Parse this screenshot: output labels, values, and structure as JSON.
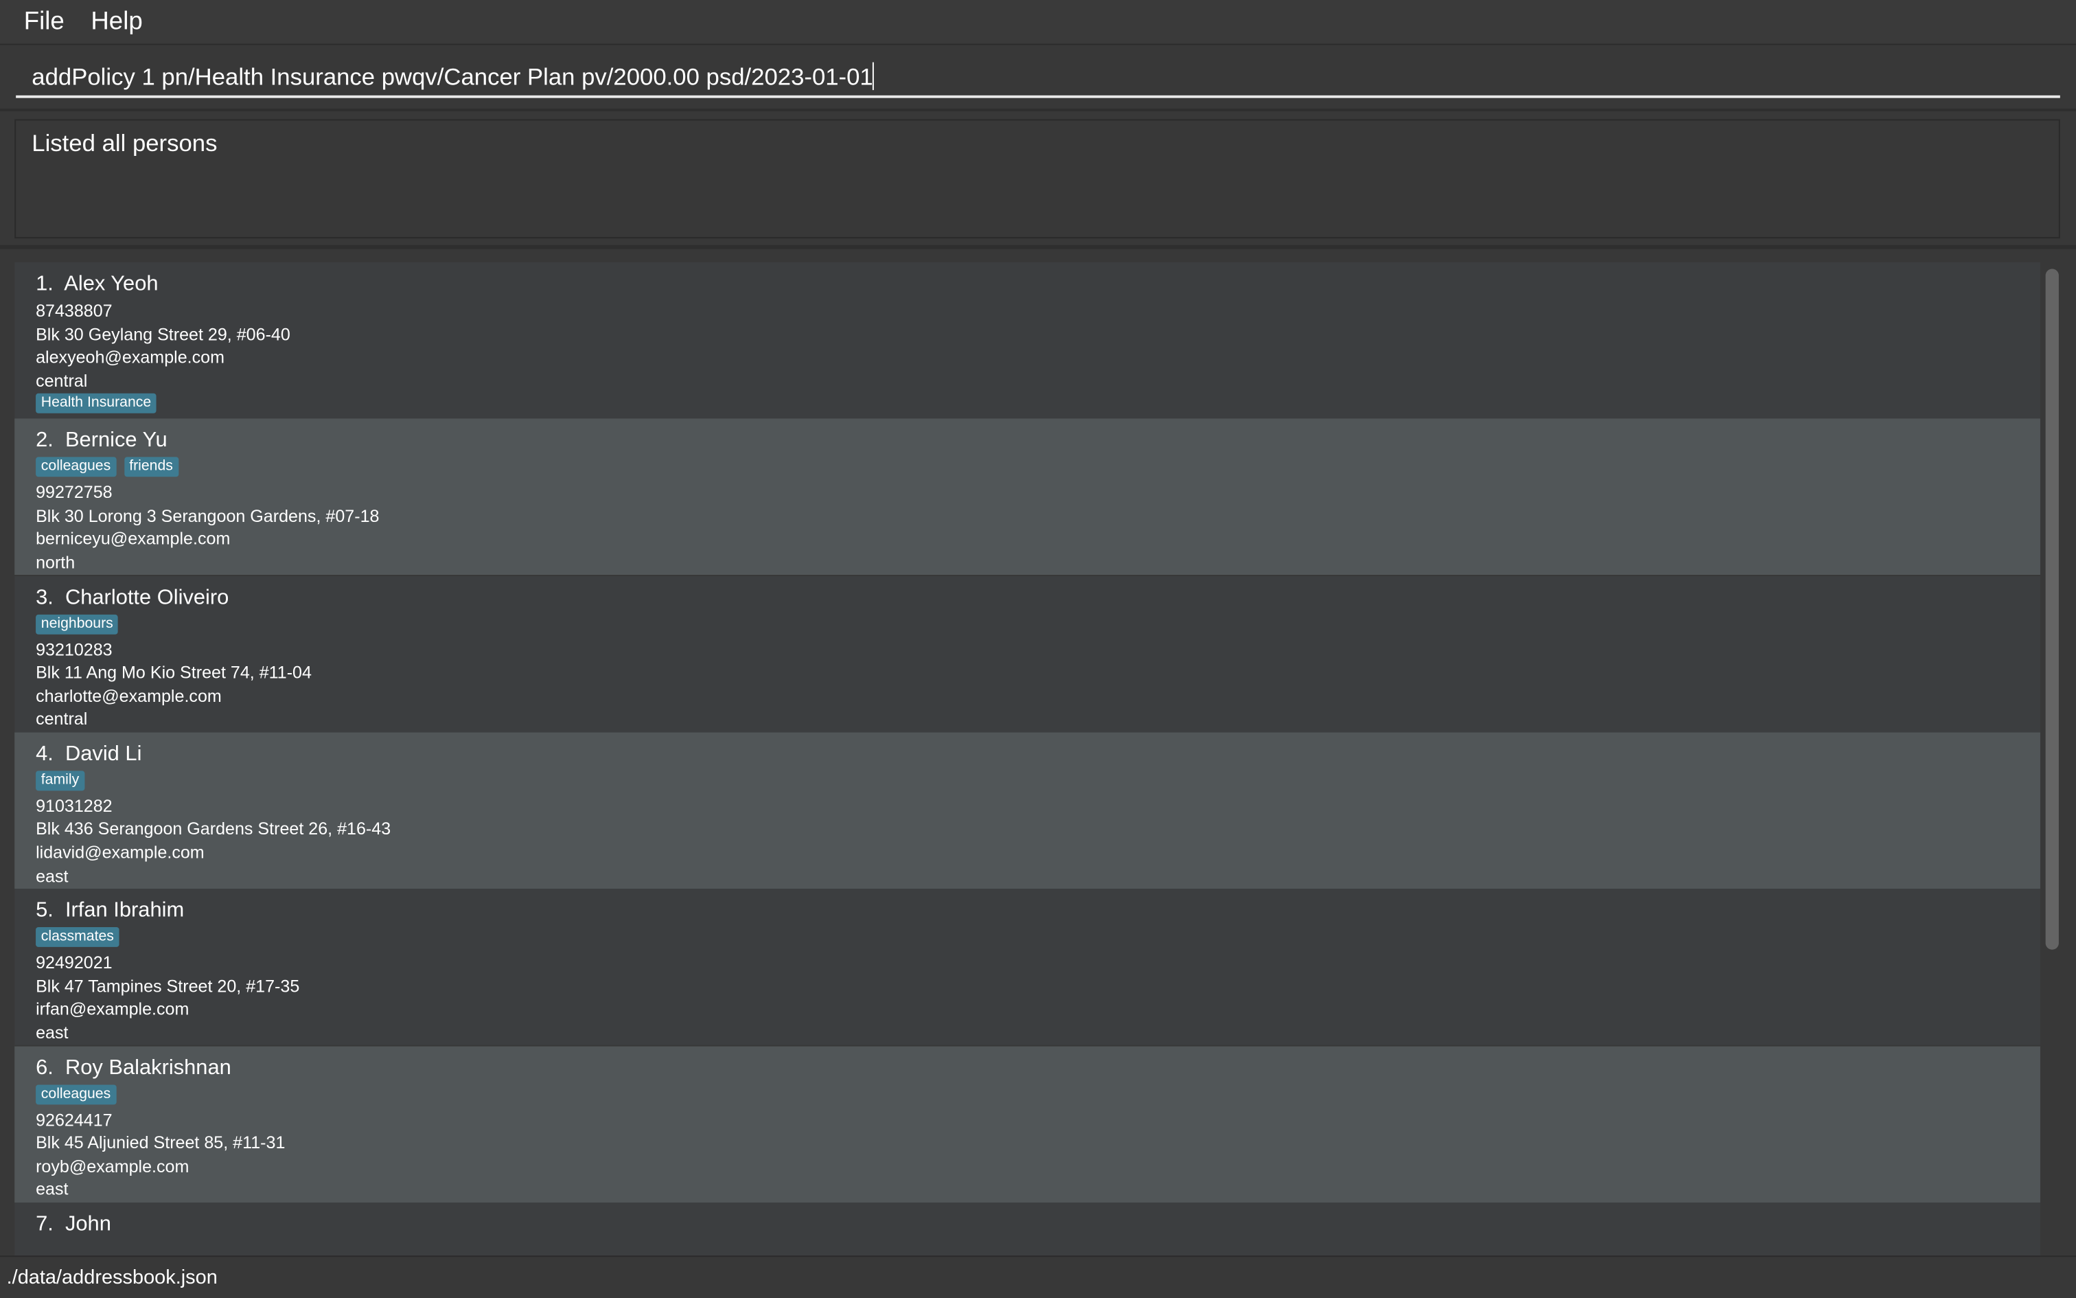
{
  "menu": {
    "file": "File",
    "help": "Help"
  },
  "command": {
    "value": "addPolicy 1 pn/Health Insurance pwqv/Cancer Plan pv/2000.00 psd/2023-01-01"
  },
  "result": {
    "text": "Listed all persons"
  },
  "persons": [
    {
      "index": "1.",
      "name": "Alex Yeoh",
      "tags_before": [],
      "phone": "87438807",
      "address": "Blk 30 Geylang Street 29, #06-40",
      "email": "alexyeoh@example.com",
      "region": "central",
      "tags_after": [
        "Health Insurance"
      ]
    },
    {
      "index": "2.",
      "name": "Bernice Yu",
      "tags_before": [
        "colleagues",
        "friends"
      ],
      "phone": "99272758",
      "address": "Blk 30 Lorong 3 Serangoon Gardens, #07-18",
      "email": "berniceyu@example.com",
      "region": "north",
      "tags_after": []
    },
    {
      "index": "3.",
      "name": "Charlotte Oliveiro",
      "tags_before": [
        "neighbours"
      ],
      "phone": "93210283",
      "address": "Blk 11 Ang Mo Kio Street 74, #11-04",
      "email": "charlotte@example.com",
      "region": "central",
      "tags_after": []
    },
    {
      "index": "4.",
      "name": "David Li",
      "tags_before": [
        "family"
      ],
      "phone": "91031282",
      "address": "Blk 436 Serangoon Gardens Street 26, #16-43",
      "email": "lidavid@example.com",
      "region": "east",
      "tags_after": []
    },
    {
      "index": "5.",
      "name": "Irfan Ibrahim",
      "tags_before": [
        "classmates"
      ],
      "phone": "92492021",
      "address": "Blk 47 Tampines Street 20, #17-35",
      "email": "irfan@example.com",
      "region": "east",
      "tags_after": []
    },
    {
      "index": "6.",
      "name": "Roy Balakrishnan",
      "tags_before": [
        "colleagues"
      ],
      "phone": "92624417",
      "address": "Blk 45 Aljunied Street 85, #11-31",
      "email": "royb@example.com",
      "region": "east",
      "tags_after": []
    },
    {
      "index": "7.",
      "name": "John",
      "tags_before": [],
      "phone": "",
      "address": "",
      "email": "",
      "region": "",
      "tags_after": []
    }
  ],
  "status": {
    "path": "./data/addressbook.json"
  },
  "colors": {
    "background": "#383838",
    "card_odd": "#3c3e40",
    "card_even": "#515658",
    "tag": "#3e7b91"
  }
}
